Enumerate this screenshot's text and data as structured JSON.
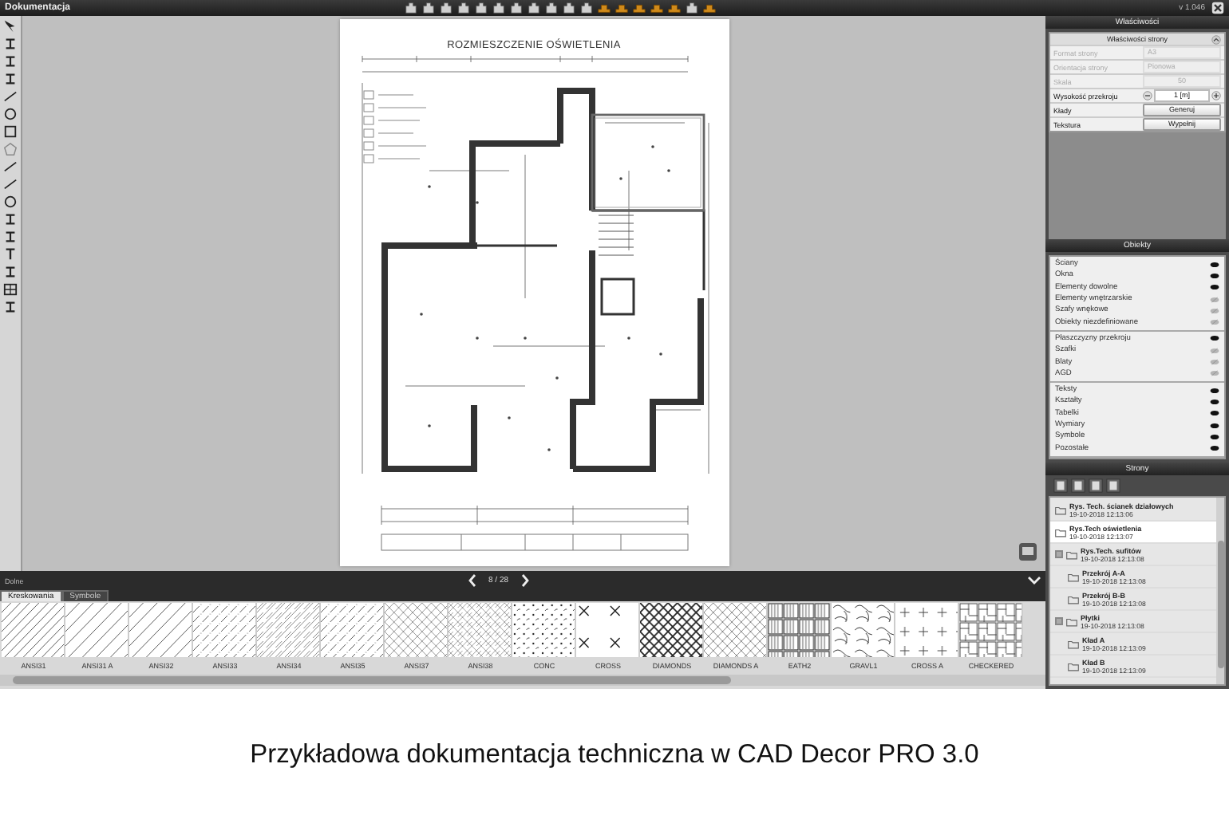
{
  "app": {
    "title": "Dokumentacja",
    "version": "v 1.046"
  },
  "page": {
    "title": "ROZMIESZCZENIE OŚWIETLENIA"
  },
  "page_nav": {
    "label": "8 / 28"
  },
  "bottom_panel": {
    "title": "Dolne",
    "tabs": [
      {
        "label": "Kreskowania",
        "selected": true
      },
      {
        "label": "Symbole",
        "selected": false
      }
    ],
    "hatches": [
      {
        "label": "ANSI31",
        "kind": "diag"
      },
      {
        "label": "ANSI31 A",
        "kind": "diag-wide"
      },
      {
        "label": "ANSI32",
        "kind": "diag-wide"
      },
      {
        "label": "ANSI33",
        "kind": "diag-dash"
      },
      {
        "label": "ANSI34",
        "kind": "diag-double"
      },
      {
        "label": "ANSI35",
        "kind": "diag-dash"
      },
      {
        "label": "ANSI37",
        "kind": "crosshatch"
      },
      {
        "label": "ANSI38",
        "kind": "crosshatch-wide"
      },
      {
        "label": "CONC",
        "kind": "dots"
      },
      {
        "label": "CROSS",
        "kind": "cross"
      },
      {
        "label": "DIAMONDS",
        "kind": "diamonds"
      },
      {
        "label": "DIAMONDS A",
        "kind": "diamonds-fine"
      },
      {
        "label": "EATH2",
        "kind": "blocks"
      },
      {
        "label": "GRAVL1",
        "kind": "gravel"
      },
      {
        "label": "CROSS A",
        "kind": "plus"
      },
      {
        "label": "CHECKERED",
        "kind": "brick"
      }
    ]
  },
  "properties": {
    "title": "Właściwości",
    "section": "Właściwości strony",
    "rows": [
      {
        "label": "Format strony",
        "kind": "select",
        "value": "A3",
        "disabled": true
      },
      {
        "label": "Orientacja strony",
        "kind": "select",
        "value": "Pionowa",
        "disabled": true
      },
      {
        "label": "Skala",
        "kind": "number",
        "value": "50",
        "disabled": true
      },
      {
        "label": "Wysokość przekroju",
        "kind": "stepper",
        "value": "1 [m]",
        "disabled": false
      },
      {
        "label": "Kłady",
        "kind": "button",
        "value": "Generuj",
        "disabled": false
      },
      {
        "label": "Tekstura",
        "kind": "button",
        "value": "Wypełnij",
        "disabled": false
      }
    ]
  },
  "objects": {
    "title": "Obiekty",
    "groups": [
      {
        "items": [
          {
            "label": "Ściany",
            "visible": true
          },
          {
            "label": "Okna",
            "visible": true
          },
          {
            "label": "Elementy dowolne",
            "visible": true
          },
          {
            "label": "Elementy wnętrzarskie",
            "visible": false
          },
          {
            "label": "Szafy wnękowe",
            "visible": false
          },
          {
            "label": "Obiekty niezdefiniowane",
            "visible": false
          }
        ]
      },
      {
        "items": [
          {
            "label": "Płaszczyzny przekroju",
            "visible": true
          },
          {
            "label": "Szafki",
            "visible": false
          },
          {
            "label": "Blaty",
            "visible": false
          },
          {
            "label": "AGD",
            "visible": false
          }
        ]
      },
      {
        "items": [
          {
            "label": "Teksty",
            "visible": true
          },
          {
            "label": "Kształty",
            "visible": true
          },
          {
            "label": "Tabelki",
            "visible": true
          },
          {
            "label": "Wymiary",
            "visible": true
          },
          {
            "label": "Symbole",
            "visible": true
          },
          {
            "label": "Pozostałe",
            "visible": true
          }
        ]
      }
    ]
  },
  "pages": {
    "title": "Strony",
    "items": [
      {
        "name": "Rys. Tech. ścianek działowych",
        "date": "19-10-2018 12:13:06",
        "selected": false
      },
      {
        "name": "Rys.Tech oświetlenia",
        "date": "19-10-2018 12:13:07",
        "selected": true
      },
      {
        "name": "Rys.Tech. sufitów",
        "date": "19-10-2018 12:13:08",
        "selected": false,
        "expanded": true,
        "children": [
          {
            "name": "Przekrój A-A",
            "date": "19-10-2018 12:13:08",
            "selected": false
          },
          {
            "name": "Przekrój B-B",
            "date": "19-10-2018 12:13:08",
            "selected": false
          }
        ]
      },
      {
        "name": "Płytki",
        "date": "19-10-2018 12:13:08",
        "selected": false,
        "expanded": true,
        "children": [
          {
            "name": "Kład A",
            "date": "19-10-2018 12:13:09",
            "selected": false
          },
          {
            "name": "Kład B",
            "date": "19-10-2018 12:13:09",
            "selected": false
          }
        ]
      }
    ]
  },
  "caption": "Przykładowa dokumentacja techniczna w CAD Decor PRO 3.0"
}
